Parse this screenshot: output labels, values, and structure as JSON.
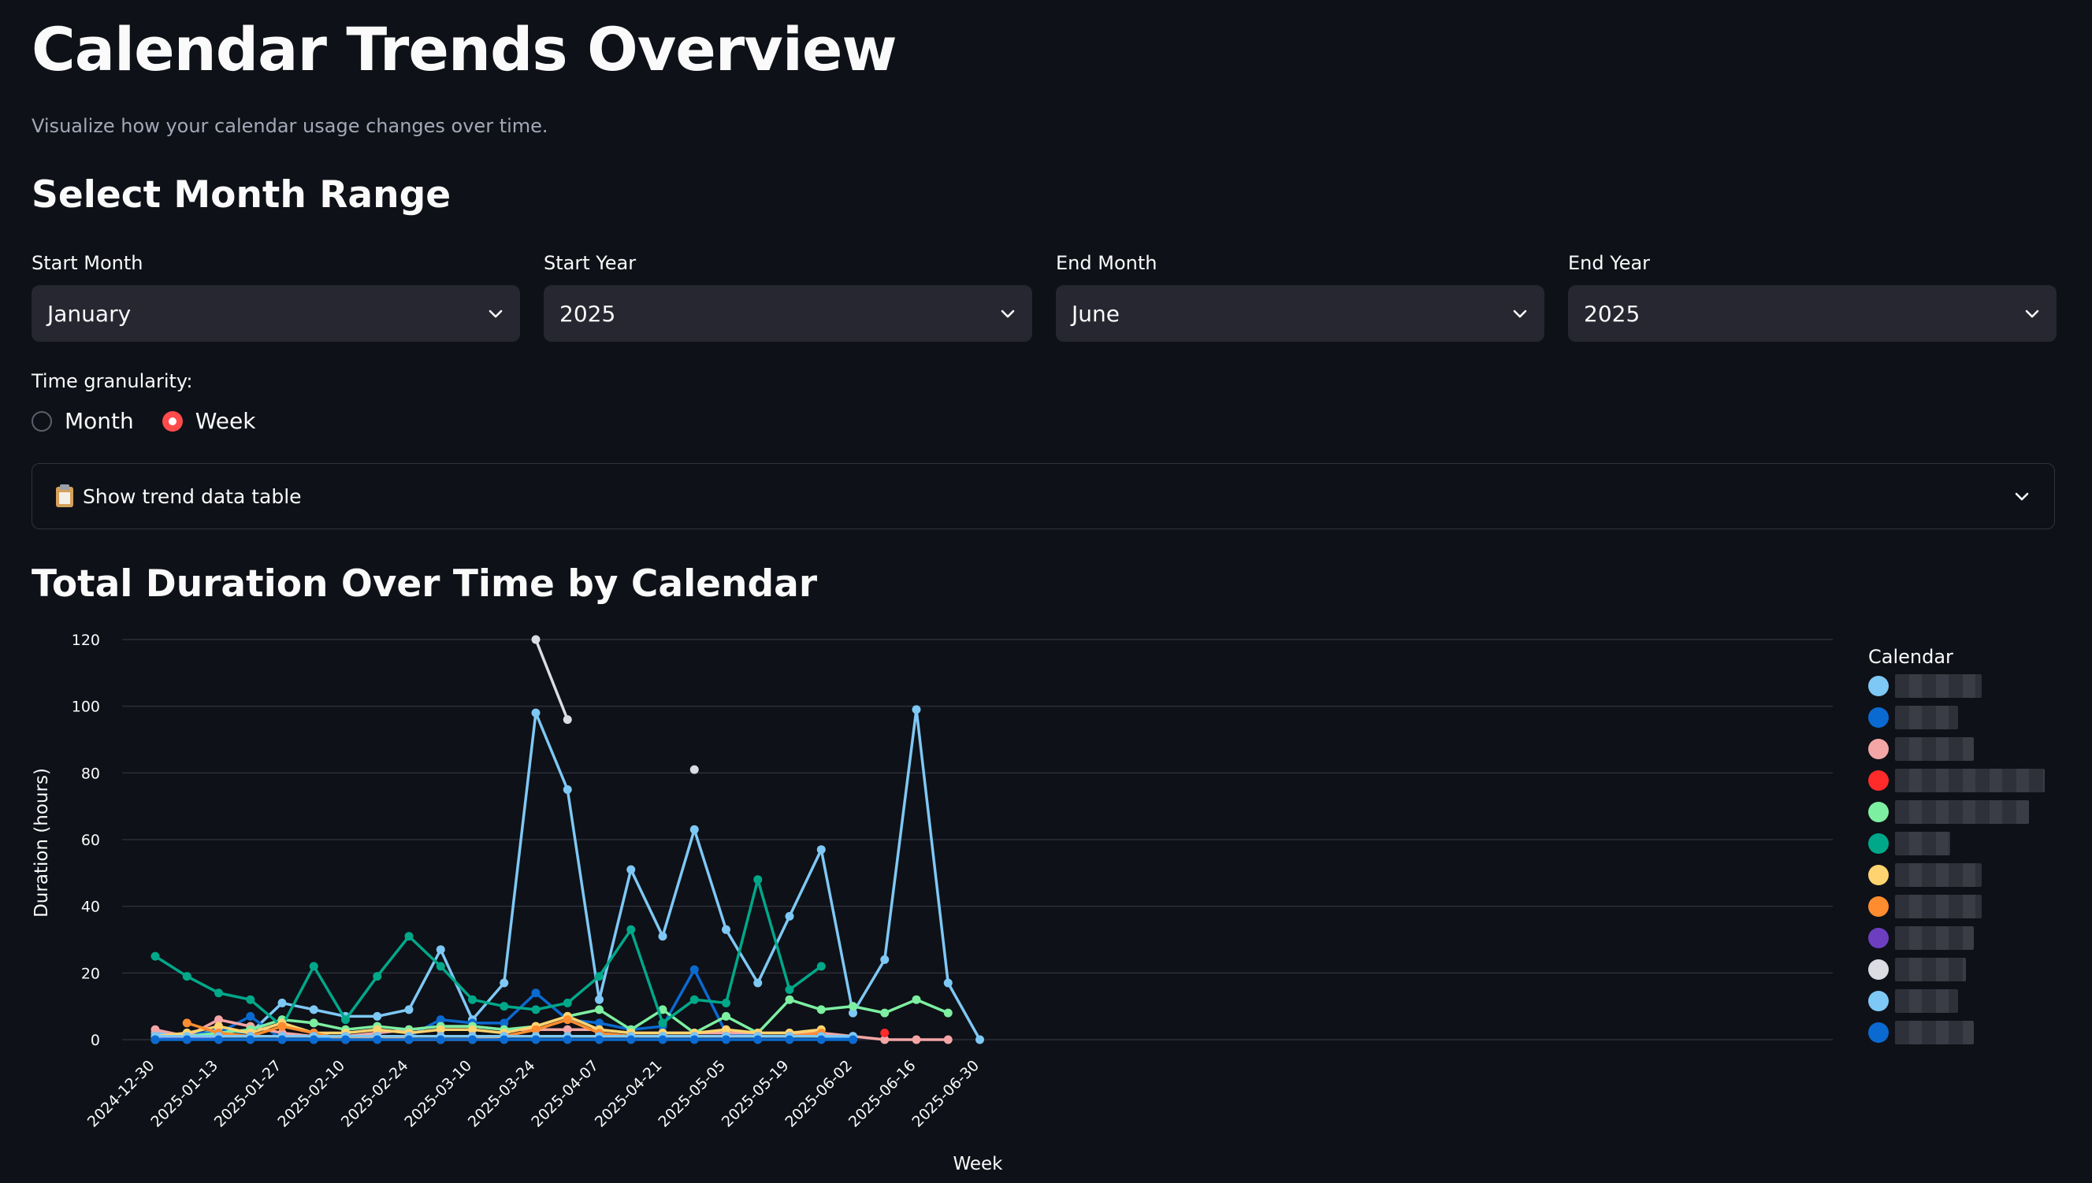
{
  "page": {
    "title": "Calendar Trends Overview",
    "subtitle": "Visualize how your calendar usage changes over time."
  },
  "range": {
    "heading": "Select Month Range",
    "fields": [
      {
        "label": "Start Month",
        "value": "January"
      },
      {
        "label": "Start Year",
        "value": "2025"
      },
      {
        "label": "End Month",
        "value": "June"
      },
      {
        "label": "End Year",
        "value": "2025"
      }
    ]
  },
  "granularity": {
    "label": "Time granularity:",
    "options": [
      {
        "label": "Month",
        "selected": false
      },
      {
        "label": "Week",
        "selected": true
      }
    ]
  },
  "expander": {
    "icon": "clipboard-icon",
    "label": "Show trend data table"
  },
  "chart_section": {
    "heading": "Total Duration Over Time by Calendar"
  },
  "chart_data": {
    "type": "line",
    "title": "",
    "xlabel": "Week",
    "ylabel": "Duration (hours)",
    "ylim": [
      0,
      120
    ],
    "yticks": [
      0,
      20,
      40,
      60,
      80,
      100,
      120
    ],
    "grid": true,
    "legend_title": "Calendar",
    "legend_placement": "right",
    "x_tick_labels": [
      "2024-12-30",
      "2025-01-13",
      "2025-01-27",
      "2025-02-10",
      "2025-02-24",
      "2025-03-10",
      "2025-03-24",
      "2025-04-07",
      "2025-04-21",
      "2025-05-05",
      "2025-05-19",
      "2025-06-02",
      "2025-06-16",
      "2025-06-30"
    ],
    "x": [
      "2024-12-30",
      "2025-01-06",
      "2025-01-13",
      "2025-01-20",
      "2025-01-27",
      "2025-02-03",
      "2025-02-10",
      "2025-02-17",
      "2025-02-24",
      "2025-03-03",
      "2025-03-10",
      "2025-03-17",
      "2025-03-24",
      "2025-03-31",
      "2025-04-07",
      "2025-04-14",
      "2025-04-21",
      "2025-04-28",
      "2025-05-05",
      "2025-05-12",
      "2025-05-19",
      "2025-05-26",
      "2025-06-02",
      "2025-06-09",
      "2025-06-16",
      "2025-06-23",
      "2025-06-30"
    ],
    "series": [
      {
        "color": "#7ec8f5",
        "values": [
          2,
          1,
          3,
          2,
          11,
          9,
          7,
          7,
          9,
          27,
          6,
          17,
          98,
          75,
          12,
          51,
          31,
          63,
          33,
          17,
          37,
          57,
          8,
          24,
          99,
          17,
          0
        ]
      },
      {
        "color": "#0b6ad1",
        "values": [
          0,
          2,
          2,
          7,
          0,
          0,
          1,
          1,
          1,
          6,
          5,
          5,
          14,
          6,
          5,
          3,
          4,
          21,
          2,
          1,
          1,
          1,
          0,
          null,
          null,
          null,
          null
        ]
      },
      {
        "color": "#f4a6a6",
        "values": [
          3,
          1,
          6,
          4,
          2,
          1,
          1,
          2,
          3,
          4,
          4,
          3,
          3,
          3,
          3,
          2,
          2,
          2,
          2,
          2,
          2,
          2,
          1,
          0,
          0,
          0,
          null
        ]
      },
      {
        "color": "#ff2b2b",
        "values": [
          null,
          null,
          null,
          null,
          null,
          null,
          null,
          null,
          null,
          null,
          null,
          null,
          null,
          null,
          null,
          null,
          null,
          null,
          null,
          null,
          null,
          null,
          null,
          2,
          null,
          null,
          null
        ]
      },
      {
        "color": "#7defa1",
        "values": [
          0,
          1,
          2,
          3,
          6,
          5,
          3,
          4,
          3,
          4,
          4,
          3,
          4,
          7,
          9,
          3,
          9,
          2,
          7,
          2,
          12,
          9,
          10,
          8,
          12,
          8,
          null
        ]
      },
      {
        "color": "#00a88a",
        "values": [
          25,
          19,
          14,
          12,
          4,
          22,
          6,
          19,
          31,
          22,
          12,
          10,
          9,
          11,
          19,
          33,
          5,
          12,
          11,
          48,
          15,
          22,
          null,
          null,
          null,
          null,
          null
        ]
      },
      {
        "color": "#ffd470",
        "values": [
          1,
          2,
          4,
          2,
          5,
          2,
          2,
          3,
          2,
          3,
          3,
          2,
          4,
          7,
          3,
          2,
          2,
          2,
          3,
          2,
          2,
          3,
          null,
          null,
          null,
          null,
          null
        ]
      },
      {
        "color": "#ff8c2f",
        "values": [
          null,
          5,
          2,
          1,
          4,
          2,
          0,
          1,
          0,
          0,
          0,
          1,
          3,
          6,
          2,
          1,
          1,
          1,
          1,
          1,
          1,
          2,
          null,
          null,
          null,
          null,
          null
        ]
      },
      {
        "color": "#6d3fc0",
        "values": [
          1,
          0,
          1,
          1,
          1,
          1,
          1,
          1,
          1,
          1,
          1,
          1,
          1,
          1,
          1,
          1,
          1,
          1,
          1,
          1,
          1,
          1,
          1,
          null,
          null,
          null,
          null
        ]
      },
      {
        "color": "#dcdde3",
        "values": [
          null,
          null,
          null,
          null,
          null,
          null,
          null,
          null,
          null,
          null,
          null,
          null,
          120,
          96,
          null,
          null,
          null,
          81,
          null,
          null,
          null,
          null,
          null,
          null,
          null,
          null,
          null
        ]
      },
      {
        "color": "#7ec8f5",
        "values": [
          1,
          1,
          1,
          1,
          1,
          1,
          1,
          1,
          1,
          1,
          1,
          1,
          1,
          1,
          1,
          1,
          1,
          1,
          1,
          1,
          1,
          1,
          1,
          null,
          null,
          null,
          null
        ]
      },
      {
        "color": "#0b6ad1",
        "values": [
          0,
          0,
          0,
          0,
          0,
          0,
          0,
          0,
          0,
          0,
          0,
          0,
          0,
          0,
          0,
          0,
          0,
          0,
          0,
          0,
          0,
          0,
          0,
          null,
          null,
          null,
          null
        ]
      }
    ]
  }
}
